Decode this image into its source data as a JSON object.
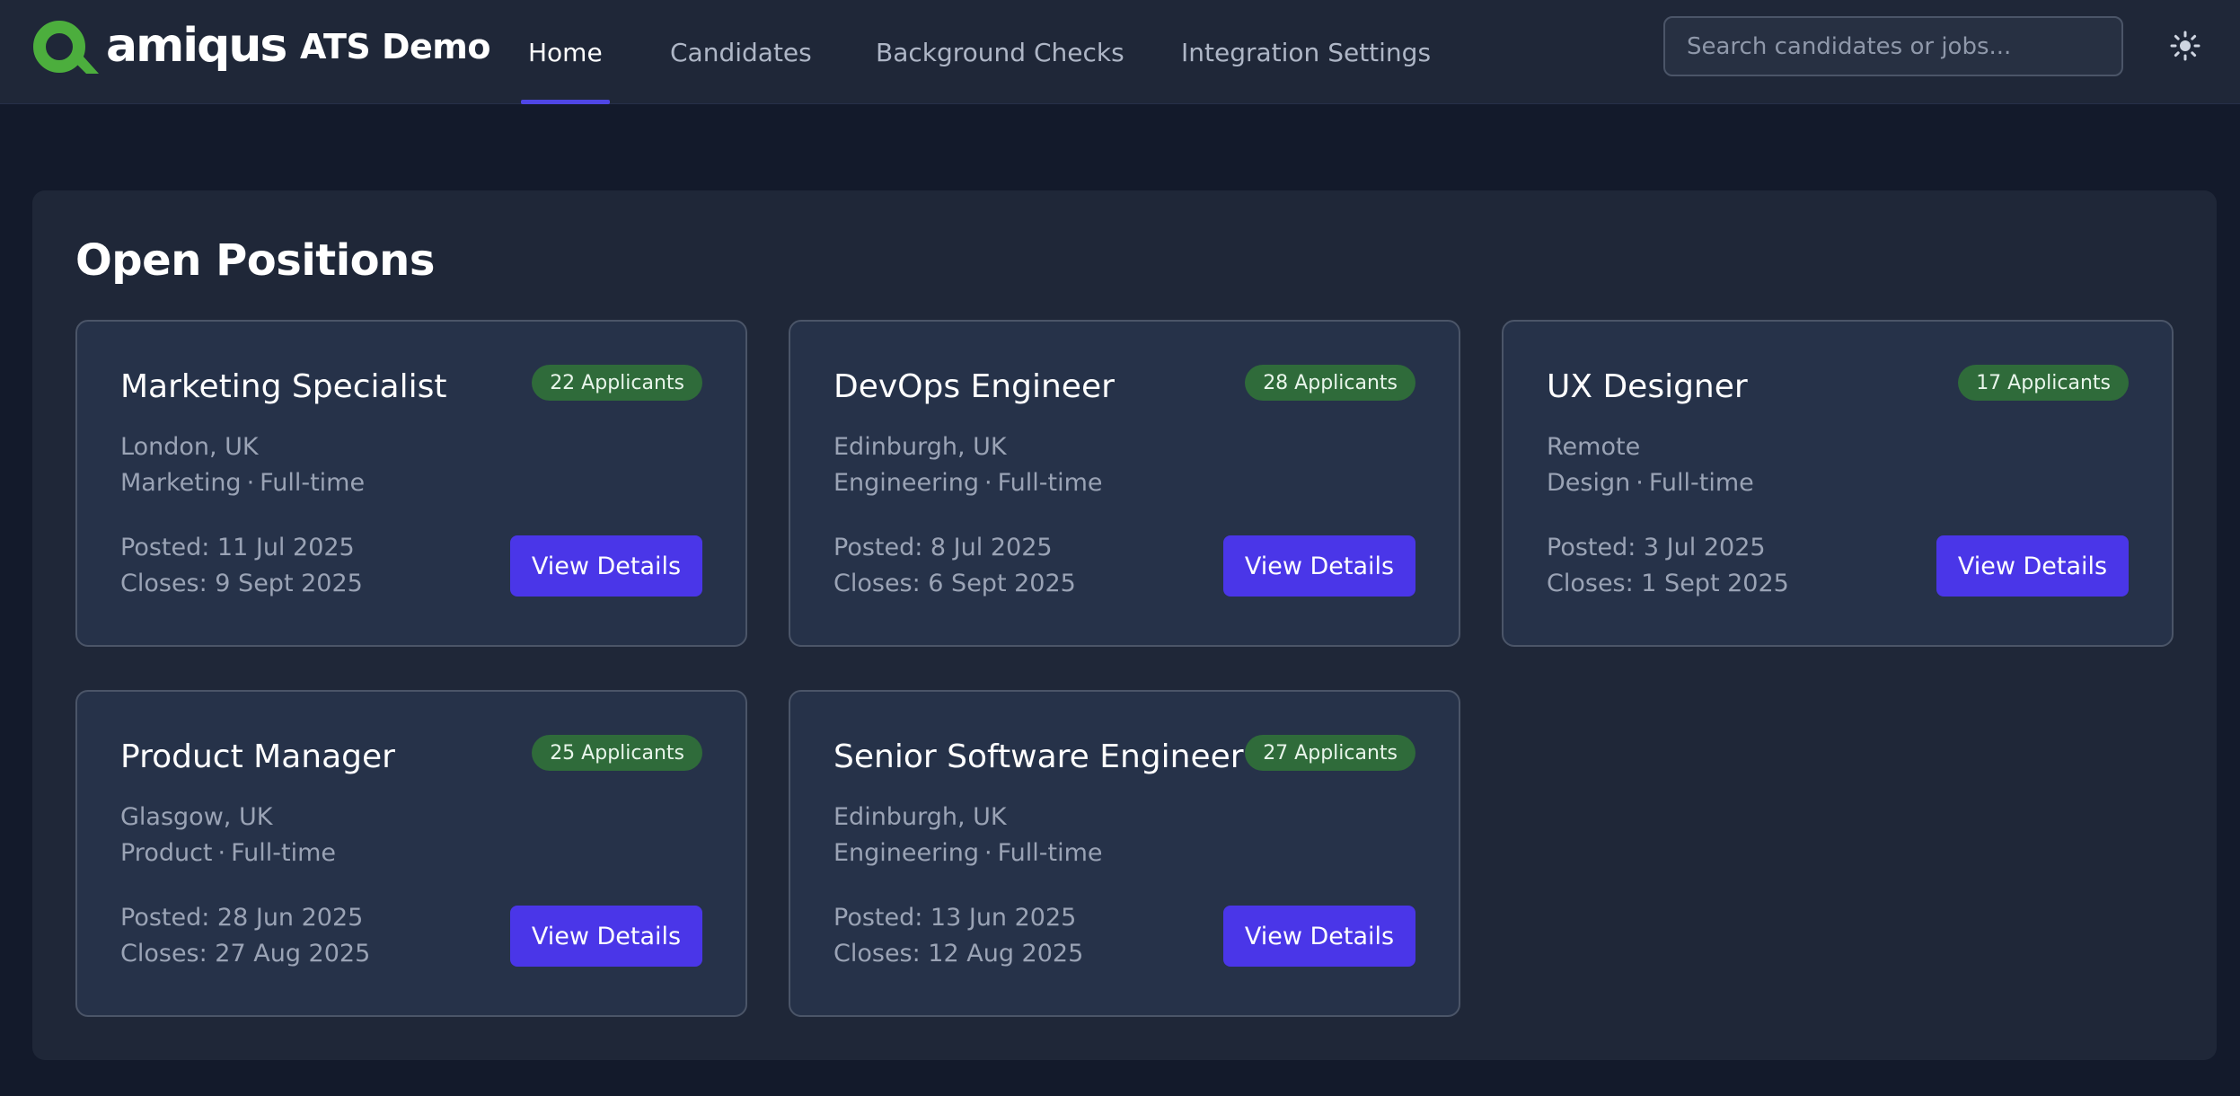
{
  "brand": {
    "logo_text": "amiqus",
    "logo_color": "#4cae3d",
    "app_name": "ATS Demo"
  },
  "nav": {
    "items": [
      {
        "label": "Home",
        "active": true
      },
      {
        "label": "Candidates",
        "active": false
      },
      {
        "label": "Background Checks",
        "active": false
      },
      {
        "label": "Integration Settings",
        "active": false
      }
    ],
    "active_color": "#4f46e5"
  },
  "search": {
    "placeholder": "Search candidates or jobs...",
    "value": ""
  },
  "theme_toggle": {
    "icon": "sun-icon"
  },
  "main": {
    "title": "Open Positions",
    "jobs": [
      {
        "title": "Marketing Specialist",
        "applicants": "22 Applicants",
        "location": "London, UK",
        "department": "Marketing",
        "type": "Full-time",
        "posted": "Posted: 11 Jul 2025",
        "closes": "Closes: 9 Sept 2025",
        "button": "View Details"
      },
      {
        "title": "DevOps Engineer",
        "applicants": "28 Applicants",
        "location": "Edinburgh, UK",
        "department": "Engineering",
        "type": "Full-time",
        "posted": "Posted: 8 Jul 2025",
        "closes": "Closes: 6 Sept 2025",
        "button": "View Details"
      },
      {
        "title": "UX Designer",
        "applicants": "17 Applicants",
        "location": "Remote",
        "department": "Design",
        "type": "Full-time",
        "posted": "Posted: 3 Jul 2025",
        "closes": "Closes: 1 Sept 2025",
        "button": "View Details"
      },
      {
        "title": "Product Manager",
        "applicants": "25 Applicants",
        "location": "Glasgow, UK",
        "department": "Product",
        "type": "Full-time",
        "posted": "Posted: 28 Jun 2025",
        "closes": "Closes: 27 Aug 2025",
        "button": "View Details"
      },
      {
        "title": "Senior Software Engineer",
        "applicants": "27 Applicants",
        "location": "Edinburgh, UK",
        "department": "Engineering",
        "type": "Full-time",
        "posted": "Posted: 13 Jun 2025",
        "closes": "Closes: 12 Aug 2025",
        "button": "View Details"
      }
    ],
    "meta_separator": "·",
    "colors": {
      "badge": "#2f6b3a",
      "button": "#4a36e8"
    }
  }
}
